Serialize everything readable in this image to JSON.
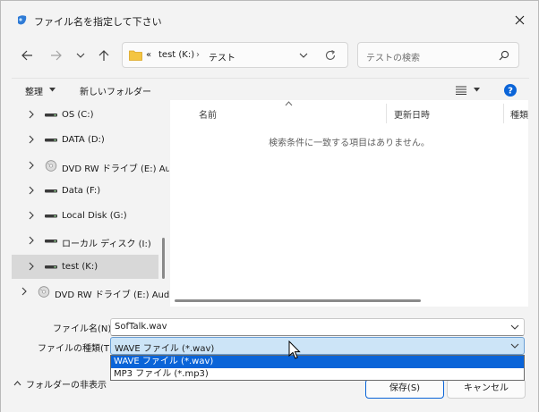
{
  "window": {
    "title": "ファイル名を指定して下さい",
    "close_icon": "close-icon"
  },
  "nav": {
    "back_icon": "back-arrow-icon",
    "forward_icon": "forward-arrow-icon",
    "recent_icon": "chevron-down-icon",
    "up_icon": "up-arrow-icon"
  },
  "address": {
    "overflow": "«",
    "segments": [
      "test (K:)",
      "テスト"
    ],
    "separator": "›"
  },
  "search": {
    "placeholder": "テストの検索"
  },
  "toolbar": {
    "organize_label": "整理",
    "new_folder_label": "新しいフォルダー"
  },
  "tree": [
    {
      "label": "OS (C:)",
      "icon": "drive-icon",
      "selected": false
    },
    {
      "label": "DATA (D:)",
      "icon": "drive-icon",
      "selected": false
    },
    {
      "label": "DVD RW ドライブ (E:) Au",
      "icon": "dvd-icon",
      "selected": false
    },
    {
      "label": "Data (F:)",
      "icon": "drive-icon",
      "selected": false
    },
    {
      "label": "Local Disk (G:)",
      "icon": "drive-icon",
      "selected": false
    },
    {
      "label": "ローカル ディスク (I:)",
      "icon": "drive-icon",
      "selected": false
    },
    {
      "label": "test (K:)",
      "icon": "drive-icon",
      "selected": true
    },
    {
      "label": "DVD RW ドライブ (E:) Audi",
      "icon": "dvd-icon",
      "selected": false
    }
  ],
  "columns": [
    "名前",
    "更新日時",
    "種類"
  ],
  "empty_message": "検索条件に一致する項目はありません。",
  "filename": {
    "label": "ファイル名(N):",
    "value": "SofTalk.wav"
  },
  "filetype": {
    "label": "ファイルの種類(T):",
    "value": "WAVE ファイル (*.wav)",
    "options": [
      "WAVE ファイル (*.wav)",
      "MP3 ファイル (*.mp3)"
    ]
  },
  "footer": {
    "hide_folders_label": "フォルダーの非表示",
    "save_label": "保存(S)",
    "cancel_label": "キャンセル"
  },
  "colors": {
    "accent": "#0a64d8",
    "selected_field": "#cce4f7",
    "help": "#0a64d8"
  }
}
